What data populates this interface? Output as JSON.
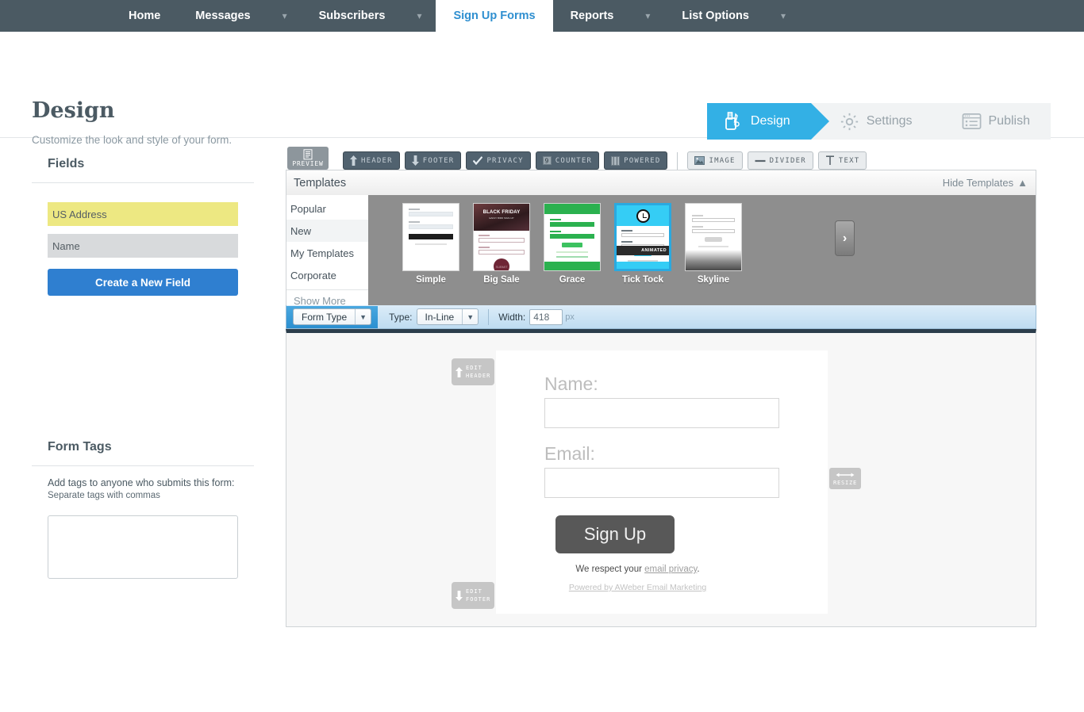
{
  "topnav": {
    "items": [
      {
        "label": "Home",
        "active": false,
        "caret": false
      },
      {
        "label": "Messages",
        "active": false,
        "caret": true
      },
      {
        "label": "Subscribers",
        "active": false,
        "caret": true
      },
      {
        "label": "Sign Up Forms",
        "active": true,
        "caret": false
      },
      {
        "label": "Reports",
        "active": false,
        "caret": true
      },
      {
        "label": "List Options",
        "active": false,
        "caret": true
      }
    ]
  },
  "page": {
    "title": "Design",
    "subtitle": "Customize the look and style of your form."
  },
  "steps": [
    {
      "label": "Design",
      "icon": "design-icon",
      "active": true
    },
    {
      "label": "Settings",
      "icon": "gear-icon",
      "active": false
    },
    {
      "label": "Publish",
      "icon": "publish-icon",
      "active": false
    }
  ],
  "sidebar": {
    "fields_title": "Fields",
    "fields": [
      {
        "label": "US Address",
        "style": "yellow"
      },
      {
        "label": "Name",
        "style": "gray"
      }
    ],
    "create_field_label": "Create a New Field",
    "tags_title": "Form Tags",
    "tags_desc": "Add tags to anyone who submits this form:",
    "tags_sub": "Separate tags with commas",
    "tags_value": "",
    "tags_placeholder": ""
  },
  "toolbar": {
    "preview_label": "PREVIEW",
    "buttons": [
      {
        "label": "HEADER",
        "icon": "arrow-up-icon",
        "style": "dark"
      },
      {
        "label": "FOOTER",
        "icon": "arrow-down-icon",
        "style": "dark"
      },
      {
        "label": "PRIVACY",
        "icon": "check-icon",
        "style": "dark"
      },
      {
        "label": "COUNTER",
        "icon": "counter-icon",
        "style": "dark"
      },
      {
        "label": "POWERED",
        "icon": "powered-icon",
        "style": "dark"
      },
      {
        "label": "IMAGE",
        "icon": "image-icon",
        "style": "light"
      },
      {
        "label": "DIVIDER",
        "icon": "divider-icon",
        "style": "light"
      },
      {
        "label": "TEXT",
        "icon": "text-icon",
        "style": "light"
      }
    ]
  },
  "templates": {
    "title": "Templates",
    "hide_label": "Hide Templates",
    "categories": [
      {
        "label": "Popular",
        "highlighted": false
      },
      {
        "label": "New",
        "highlighted": true
      },
      {
        "label": "My Templates",
        "highlighted": false
      },
      {
        "label": "Corporate",
        "highlighted": false
      }
    ],
    "show_more_label": "Show More",
    "items": [
      {
        "name": "Simple",
        "selected": false
      },
      {
        "name": "Big Sale",
        "selected": false,
        "headline": "BLACK FRIDAY",
        "subhead": "EARLY BIRD SIGN-UP",
        "button": "SUBMIT"
      },
      {
        "name": "Grace",
        "selected": false
      },
      {
        "name": "Tick Tock",
        "selected": true,
        "badge": "ANIMATED"
      },
      {
        "name": "Skyline",
        "selected": false
      }
    ],
    "next_label": "›"
  },
  "formtype_bar": {
    "form_type_label": "Form Type",
    "type_label": "Type:",
    "type_value": "In-Line",
    "width_label": "Width:",
    "width_value": "418",
    "px_label": "px"
  },
  "preview": {
    "edit_header_line1": "EDIT",
    "edit_header_line2": "HEADER",
    "edit_footer_line1": "EDIT",
    "edit_footer_line2": "FOOTER",
    "resize_label": "RESIZE",
    "name_label": "Name:",
    "email_label": "Email:",
    "submit_label": "Sign Up",
    "privacy_prefix": "We respect your ",
    "privacy_link": "email privacy",
    "privacy_suffix": ".",
    "powered_label": "Powered by AWeber Email Marketing"
  },
  "colors": {
    "nav_bg": "#4b5a63",
    "accent_blue": "#33b0e5",
    "button_blue": "#2f7fd0",
    "field_yellow": "#ede882",
    "selected_border": "#2aa9e0"
  }
}
